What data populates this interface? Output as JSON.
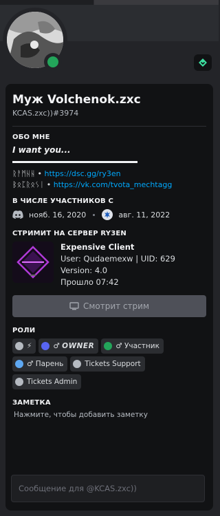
{
  "profile": {
    "display_name": "Муж Volchenok.zxc",
    "tag": "KCAS.zxc))#3974",
    "status": "online"
  },
  "about": {
    "title": "Обо мне",
    "line1": "I want you...",
    "links": [
      {
        "label": "ᚱᚨᛗᚺᚺ",
        "separator": " • ",
        "url": "https://dsc.gg/ry3en"
      },
      {
        "label": "ᛒᛟᛈᚱᛟᛊᛁ",
        "separator": " • ",
        "url": "https://vk.com/tvota_mechtagg"
      }
    ]
  },
  "member_since": {
    "title": "В числе участников с",
    "discord_date": "нояб. 16, 2020",
    "server_date": "авг. 11, 2022"
  },
  "activity": {
    "title": "Стримит на сервер RY3EN",
    "name": "Expensive Client",
    "details": "User: Qudaemexw | UID: 629",
    "state": "Version: 4.0",
    "elapsed": "Прошло 07:42",
    "watch_button": "Смотрит стрим"
  },
  "roles": {
    "title": "Роли",
    "items": [
      {
        "label": "",
        "color": "#b5bac1",
        "glyph": "⚡"
      },
      {
        "label": "OWNER",
        "color": "#5865f2",
        "glyph": "♂",
        "bold": true
      },
      {
        "label": "Участник",
        "color": "#23a55a",
        "glyph": "♂"
      },
      {
        "label": "Парень",
        "color": "#5ea8f2",
        "glyph": "♂"
      },
      {
        "label": "Tickets Support",
        "color": "#b5bac1"
      },
      {
        "label": "Tickets Admin",
        "color": "#b5bac1"
      }
    ]
  },
  "note": {
    "title": "Заметка",
    "placeholder": "Нажмите, чтобы добавить заметку"
  },
  "message": {
    "placeholder": "Сообщение для @KCAS.zxc))"
  },
  "colors": {
    "background": "#232428",
    "card": "#111214",
    "link": "#00a8fc",
    "online": "#23a55a"
  }
}
